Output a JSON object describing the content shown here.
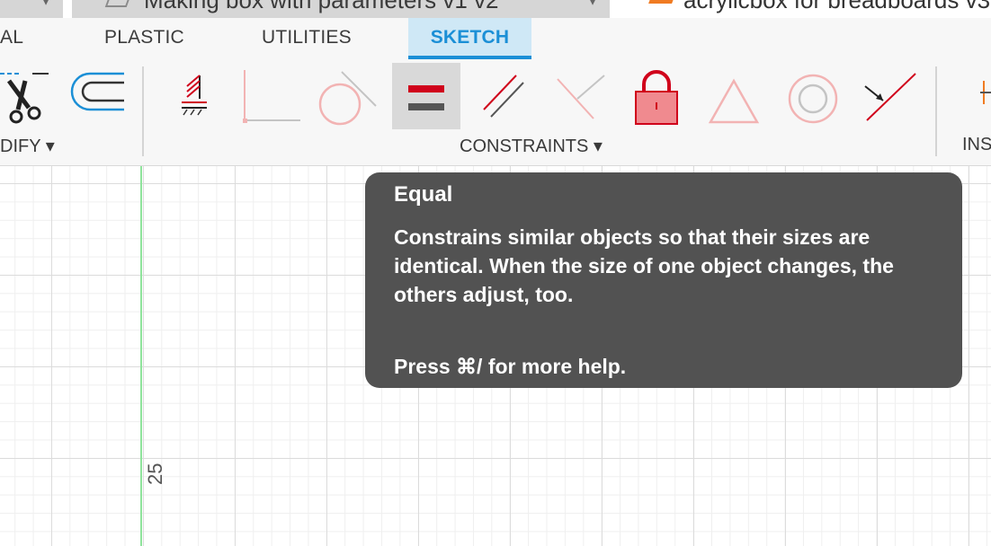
{
  "doc_tabs": [
    {
      "label": "▾"
    },
    {
      "label": "Making box with parameters v1 v2",
      "chevron": "▾"
    },
    {
      "label": "acrylicbox for breadboards v3"
    }
  ],
  "ribbon_tabs": [
    "AL",
    "PLASTIC",
    "UTILITIES",
    "SKETCH"
  ],
  "groups": {
    "modify": "DIFY ▾",
    "constraints": "CONSTRAINTS ▾",
    "inspect": "INS"
  },
  "tools": [
    {
      "name": "trim",
      "icon": "scissors-icon"
    },
    {
      "name": "offset",
      "icon": "offset-icon"
    },
    {
      "name": "fix",
      "icon": "fix-icon"
    },
    {
      "name": "perpendicular",
      "icon": "perpendicular-icon"
    },
    {
      "name": "tangent",
      "icon": "tangent-icon"
    },
    {
      "name": "equal",
      "icon": "equal-icon"
    },
    {
      "name": "parallel",
      "icon": "parallel-icon"
    },
    {
      "name": "coincident-lines",
      "icon": "angle-icon"
    },
    {
      "name": "lock",
      "icon": "lock-icon"
    },
    {
      "name": "triangle",
      "icon": "triangle-icon"
    },
    {
      "name": "concentric",
      "icon": "concentric-icon"
    },
    {
      "name": "midpoint",
      "icon": "midpoint-icon"
    }
  ],
  "canvas": {
    "dimension_label": "25"
  },
  "tooltip": {
    "title": "Equal",
    "description": "Constrains similar objects so that their sizes are identical. When the size of one object changes, the others adjust, too.",
    "help": "Press ⌘/ for more help."
  },
  "colors": {
    "accent": "#1b8fd6",
    "active_tab_bg": "#cfe8f6",
    "constraint_red": "#d0021b",
    "constraint_pink": "#f2b3b3",
    "tooltip_bg": "#525252",
    "axis_green": "#8fe39c"
  }
}
